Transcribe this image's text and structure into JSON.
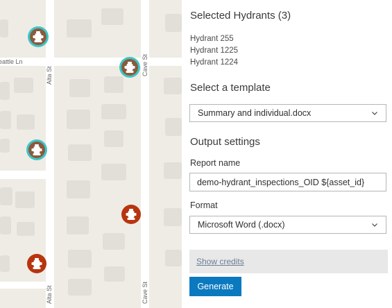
{
  "map": {
    "streets": [
      {
        "name": "eattle Ln"
      },
      {
        "name": "Alta St"
      },
      {
        "name": "Cave St"
      }
    ],
    "hydrants": [
      {
        "label": "hydrant-selected",
        "status": "selected"
      },
      {
        "label": "hydrant-selected",
        "status": "selected"
      },
      {
        "label": "hydrant-selected",
        "status": "selected"
      },
      {
        "label": "hydrant",
        "status": "unselected"
      },
      {
        "label": "hydrant",
        "status": "unselected"
      }
    ],
    "colors": {
      "selected_fill": "#8a5a3e",
      "selected_ring": "#3ec6c6",
      "unselected_fill": "#b7350e",
      "land": "#efece6",
      "street": "#ffffff",
      "building": "#e0ddd6"
    }
  },
  "panel": {
    "title": "Selected Hydrants (3)",
    "selected": [
      "Hydrant 255",
      "Hydrant 1225",
      "Hydrant 1224"
    ],
    "template_heading": "Select a template",
    "template_value": "Summary and individual.docx",
    "output_heading": "Output settings",
    "report_name_label": "Report name",
    "report_name_value": "demo-hydrant_inspections_OID ${asset_id}",
    "format_label": "Format",
    "format_value": "Microsoft Word (.docx)",
    "credits_label": "Show credits",
    "generate_label": "Generate",
    "colors": {
      "accent": "#0b79bf"
    }
  }
}
